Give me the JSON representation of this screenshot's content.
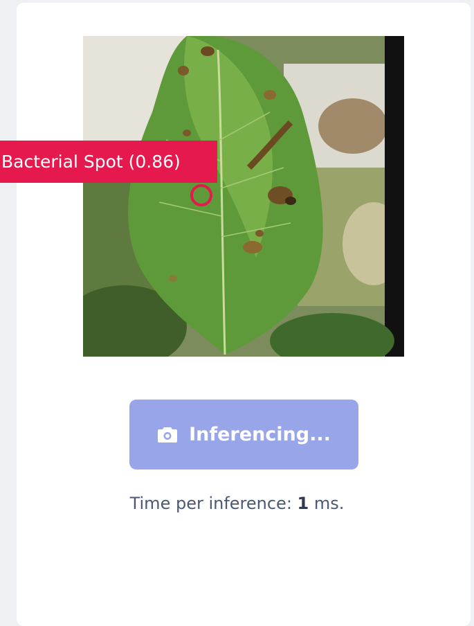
{
  "detection": {
    "label": "Bacterial Spot (0.86)",
    "color": "#e5194e"
  },
  "image": {
    "subject": "pepper leaf with bacterial spot lesions"
  },
  "button": {
    "label": "Inferencing...",
    "icon": "camera-icon",
    "color": "#98a5e9"
  },
  "timing": {
    "prefix": "Time per inference: ",
    "value": "1",
    "suffix": " ms."
  }
}
